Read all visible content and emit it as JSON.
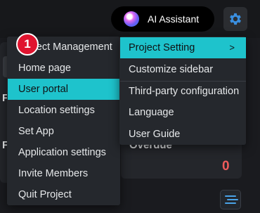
{
  "header": {
    "ai_assistant_label": "AI Assistant"
  },
  "background": {
    "letter_top": "F",
    "letter_bottom": "F",
    "overdue_title": "Overdue",
    "overdue_count": "0"
  },
  "menu": {
    "items": [
      {
        "label": "Project Management"
      },
      {
        "label": "Home page"
      },
      {
        "label": "User portal",
        "active": true
      },
      {
        "label": "Location settings"
      },
      {
        "label": "Set App"
      },
      {
        "label": "Application settings"
      },
      {
        "label": "Invite Members"
      },
      {
        "label": "Quit Project"
      }
    ]
  },
  "submenu": {
    "items": [
      {
        "label": "Project Setting",
        "active": true,
        "chevron": ">"
      },
      {
        "label": "Customize sidebar"
      },
      {
        "label": "Third-party configuration"
      },
      {
        "label": "Language"
      },
      {
        "label": "User Guide"
      }
    ]
  },
  "step_badge": {
    "number": "1"
  },
  "colors": {
    "accent": "#1ec3cc",
    "badge": "#e0142f",
    "overdue": "#ef5b5b"
  }
}
